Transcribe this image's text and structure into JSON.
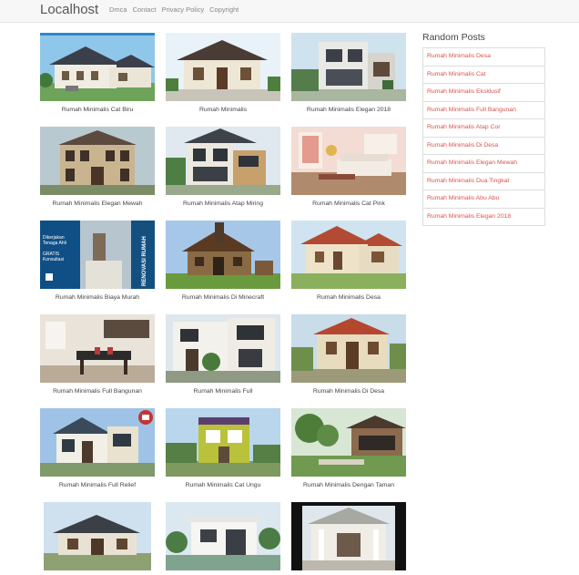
{
  "header": {
    "brand": "Localhost",
    "nav": [
      "Dmca",
      "Contact",
      "Privacy Policy",
      "Copyright"
    ]
  },
  "posts": [
    {
      "title": "Rumah Minimalis Cat Biru",
      "image_icon": "house-photo"
    },
    {
      "title": "Rumah Minimalis",
      "image_icon": "house-photo"
    },
    {
      "title": "Rumah Minimalis Elegan 2018",
      "image_icon": "house-photo"
    },
    {
      "title": "Rumah Minimalis Elegan Mewah",
      "image_icon": "house-photo"
    },
    {
      "title": "Rumah Minimalis Atap Miring",
      "image_icon": "house-photo"
    },
    {
      "title": "Rumah Minimalis Cat Pink",
      "image_icon": "interior-photo"
    },
    {
      "title": "Rumah Minimalis Biaya Murah",
      "image_icon": "ad-banner",
      "ad_text": "Dikerjakan Tenaga Ahli GRATIS Konsultasi",
      "ad_side": "RENOVASI RUMAH"
    },
    {
      "title": "Rumah Minimalis Di Minecraft",
      "image_icon": "minecraft-house"
    },
    {
      "title": "Rumah Minimalis Desa",
      "image_icon": "house-photo"
    },
    {
      "title": "Rumah Minimalis Full Bangunan",
      "image_icon": "interior-photo"
    },
    {
      "title": "Rumah Minimalis Full",
      "image_icon": "house-photo"
    },
    {
      "title": "Rumah Minimalis Di Desa",
      "image_icon": "house-photo"
    },
    {
      "title": "Rumah Minimalis Full Relief",
      "image_icon": "house-photo"
    },
    {
      "title": "Rumah Minimalis Cat Ungu",
      "image_icon": "house-photo"
    },
    {
      "title": "Rumah Minimalis Dengan Taman",
      "image_icon": "garden-photo"
    },
    {
      "title": "",
      "image_icon": "house-photo"
    },
    {
      "title": "",
      "image_icon": "house-photo"
    },
    {
      "title": "",
      "image_icon": "house-photo"
    }
  ],
  "sidebar": {
    "title": "Random Posts",
    "items": [
      "Rumah Minimalis Desa",
      "Rumah Minimalis Cat",
      "Rumah Minimalis Eksklusif",
      "Rumah Minimalis Full Bangunan",
      "Rumah Minimalis Atap Cor",
      "Rumah Minimalis Di Desa",
      "Rumah Minimalis Elegan Mewah",
      "Rumah Minimalis Dua Tingkat",
      "Rumah Minimalis Abu Abu",
      "Rumah Minimalis Elegan 2018"
    ]
  },
  "colors": {
    "link": "#d9534f",
    "navbar_bg": "#f7f7f7"
  }
}
